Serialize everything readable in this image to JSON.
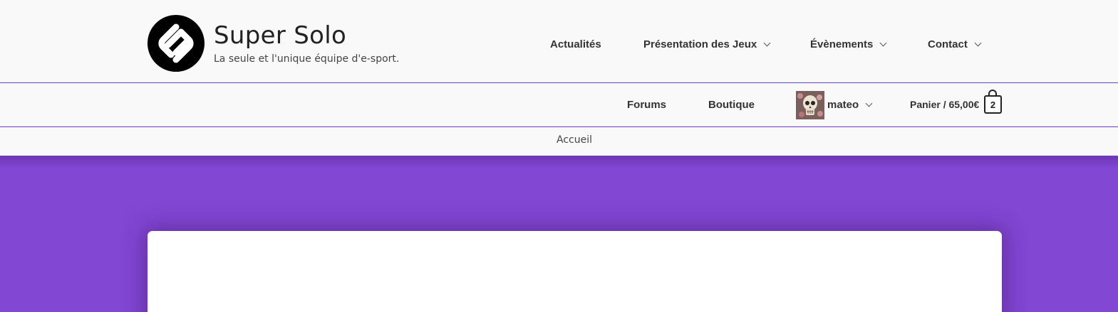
{
  "header": {
    "logo_icon": "super-solo-logo",
    "title": "Super Solo",
    "tagline": "La seule et l'unique équipe d'e-sport."
  },
  "primary_nav": [
    {
      "label": "Actualités",
      "has_dropdown": false
    },
    {
      "label": "Présentation des Jeux",
      "has_dropdown": true
    },
    {
      "label": "Évènements",
      "has_dropdown": true
    },
    {
      "label": "Contact",
      "has_dropdown": true
    }
  ],
  "secondary_nav": {
    "forums": "Forums",
    "shop": "Boutique",
    "user": {
      "name": "mateo",
      "avatar_icon": "skull-avatar",
      "has_dropdown": true
    },
    "cart": {
      "label": "Panier / 65,00€",
      "count": "2",
      "icon": "shopping-bag-icon"
    }
  },
  "breadcrumb": "Accueil",
  "colors": {
    "page_background": "#8247d3",
    "header_background": "#f9f9f9",
    "text": "#333333"
  }
}
